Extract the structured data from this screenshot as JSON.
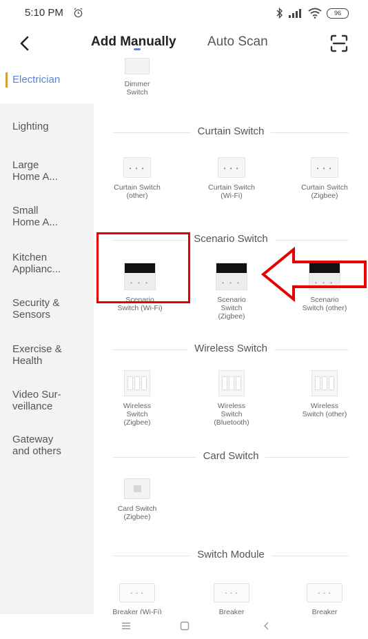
{
  "status_bar": {
    "time": "5:10 PM",
    "battery": "96"
  },
  "header": {
    "tabs": [
      {
        "label": "Add Manually",
        "active": true
      },
      {
        "label": "Auto Scan",
        "active": false
      }
    ],
    "accent_color": "#5a83d8"
  },
  "sidebar": {
    "items": [
      {
        "label": "Electrician",
        "selected": true
      },
      {
        "label": "Lighting"
      },
      {
        "label": "Large\nHome A..."
      },
      {
        "label": "Small\nHome A..."
      },
      {
        "label": "Kitchen\nApplianc..."
      },
      {
        "label": "Security &\nSensors"
      },
      {
        "label": "Exercise &\nHealth"
      },
      {
        "label": "Video Sur-\nveillance"
      },
      {
        "label": "Gateway\nand others"
      }
    ]
  },
  "content": {
    "top_device": {
      "label": "Dimmer\nSwitch"
    },
    "sections": [
      {
        "title": "Curtain Switch",
        "devices": [
          {
            "label": "Curtain Switch\n(other)"
          },
          {
            "label": "Curtain Switch\n(Wi-Fi)"
          },
          {
            "label": "Curtain Switch\n(Zigbee)"
          }
        ]
      },
      {
        "title": "Scenario Switch",
        "devices": [
          {
            "label": "Scenario\nSwitch (Wi-Fi)"
          },
          {
            "label": "Scenario\nSwitch\n(Zigbee)"
          },
          {
            "label": "Scenario\nSwitch (other)"
          }
        ]
      },
      {
        "title": "Wireless Switch",
        "devices": [
          {
            "label": "Wireless\nSwitch\n(Zigbee)"
          },
          {
            "label": "Wireless\nSwitch\n(Bluetooth)"
          },
          {
            "label": "Wireless\nSwitch (other)"
          }
        ]
      },
      {
        "title": "Card Switch",
        "devices": [
          {
            "label": "Card Switch\n(Zigbee)"
          }
        ]
      },
      {
        "title": "Switch Module",
        "devices": [
          {
            "label": "Breaker (Wi-Fi)"
          },
          {
            "label": "Breaker"
          },
          {
            "label": "Breaker"
          }
        ]
      }
    ]
  },
  "annotations": {
    "color": "#e60000"
  }
}
